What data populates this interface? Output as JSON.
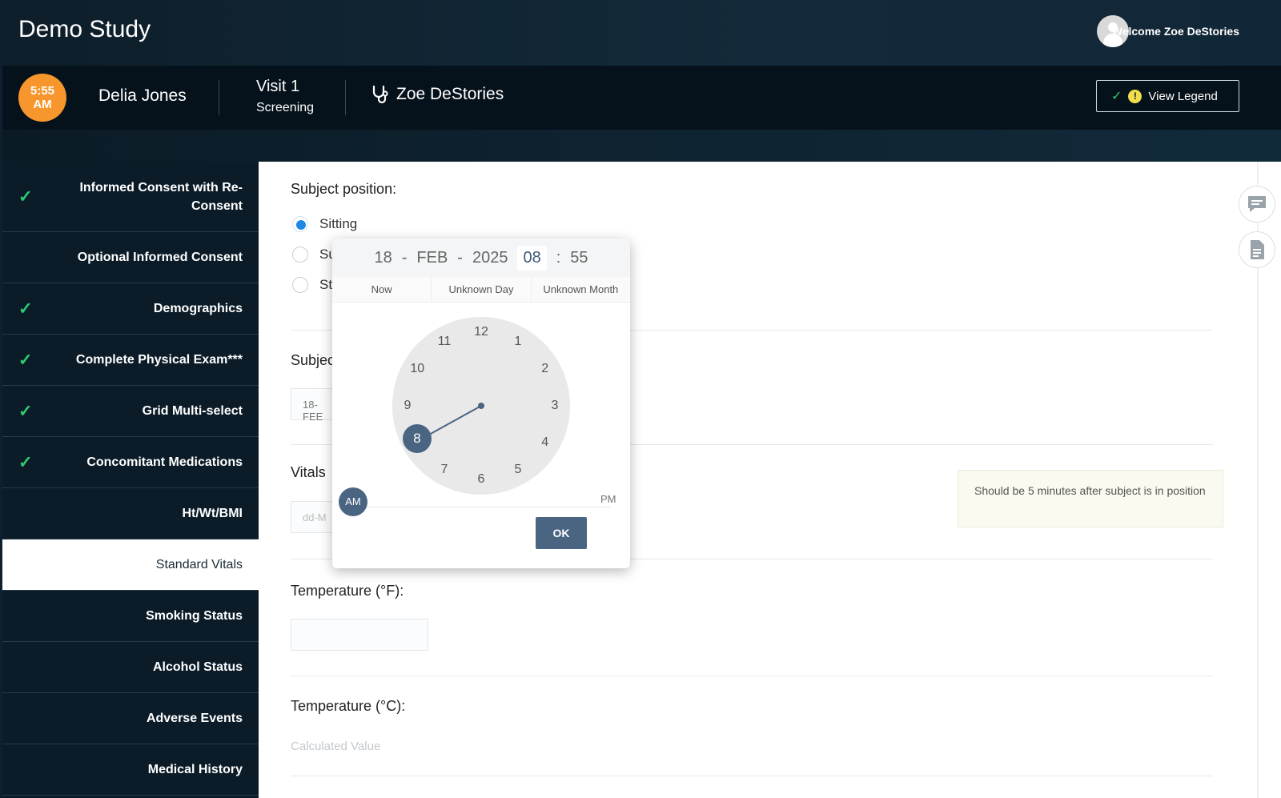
{
  "header": {
    "app_title": "Demo Study",
    "welcome": "Welcome Zoe DeStories",
    "avatar_icon": "user-avatar-icon"
  },
  "subject_bar": {
    "time_top": "5:55",
    "time_bottom": "AM",
    "subject_name": "Delia Jones",
    "visit_name": "Visit 1",
    "visit_sub": "Screening",
    "investigator": "Zoe DeStories",
    "legend_button": "View Legend",
    "legend_warn": "!"
  },
  "sidebar": {
    "items": [
      {
        "label": "Informed Consent with Re-Consent",
        "done": true
      },
      {
        "label": "Optional Informed Consent",
        "done": false
      },
      {
        "label": "Demographics",
        "done": true
      },
      {
        "label": "Complete Physical Exam***",
        "done": true
      },
      {
        "label": "Grid Multi-select",
        "done": true
      },
      {
        "label": "Concomitant Medications",
        "done": true
      },
      {
        "label": "Ht/Wt/BMI",
        "done": false
      },
      {
        "label": "Standard Vitals",
        "done": false,
        "active": true
      },
      {
        "label": "Smoking Status",
        "done": false
      },
      {
        "label": "Alcohol Status",
        "done": false
      },
      {
        "label": "Adverse Events",
        "done": false
      },
      {
        "label": "Medical History",
        "done": false
      }
    ],
    "check_glyph": "✓"
  },
  "form": {
    "position_label": "Subject position:",
    "options": [
      "Sitting",
      "Su",
      "St"
    ],
    "selected_option": "Sitting",
    "subject_label_partial": "Subjec",
    "date_value_partial": "18-FEE",
    "vitals_label_partial": "Vitals",
    "vitals_placeholder_partial": "dd-M",
    "vitals_note": "Should be 5 minutes after subject is in position",
    "temp_f_label": "Temperature (°F):",
    "temp_c_label": "Temperature (°C):",
    "calculated": "Calculated Value"
  },
  "picker": {
    "day": "18",
    "month": "FEB",
    "year": "2025",
    "hour": "08",
    "minute": "55",
    "sep_dash": "-",
    "sep_colon": ":",
    "shortcuts": [
      "Now",
      "Unknown Day",
      "Unknown Month"
    ],
    "clock_numbers": [
      "12",
      "1",
      "2",
      "3",
      "4",
      "5",
      "6",
      "7",
      "8",
      "9",
      "10",
      "11"
    ],
    "selected_hour": "8",
    "am": "AM",
    "pm": "PM",
    "ok": "OK"
  },
  "colors": {
    "accent": "#4a6582",
    "check": "#2ecc71",
    "badge": "#f6962d",
    "radio": "#1e88e5"
  }
}
